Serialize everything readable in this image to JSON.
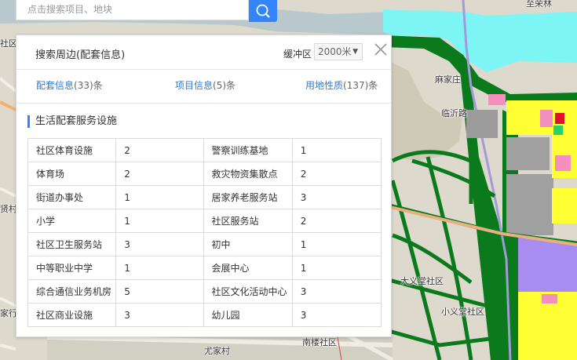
{
  "search": {
    "placeholder": "点击搜索项目、地块"
  },
  "map": {
    "labels": [
      "至荣林",
      "社区",
      "麻家庄",
      "临沂路",
      "贤村",
      "家行",
      "大义堂社区",
      "小义堂社区",
      "尤家村",
      "南楼社区"
    ]
  },
  "panel": {
    "title": "搜索周边(配套信息)",
    "buffer_label": "缓冲区",
    "buffer_value": "2000米",
    "tabs": [
      {
        "name": "配套信息",
        "count": "(33)条"
      },
      {
        "name": "项目信息",
        "count": "(5)条"
      },
      {
        "name": "用地性质",
        "count": "(137)条"
      }
    ],
    "section_title": "生活配套服务设施",
    "rows": [
      {
        "name1": "社区体育设施",
        "val1": "2",
        "name2": "警察训练基地",
        "val2": "1"
      },
      {
        "name1": "体育场",
        "val1": "2",
        "name2": "救灾物资集散点",
        "val2": "2"
      },
      {
        "name1": "街道办事处",
        "val1": "1",
        "name2": "居家养老服务站",
        "val2": "3"
      },
      {
        "name1": "小学",
        "val1": "1",
        "name2": "社区服务站",
        "val2": "2"
      },
      {
        "name1": "社区卫生服务站",
        "val1": "3",
        "name2": "初中",
        "val2": "1"
      },
      {
        "name1": "中等职业中学",
        "val1": "1",
        "name2": "会展中心",
        "val2": "1"
      },
      {
        "name1": "综合通信业务机房",
        "val1": "5",
        "name2": "社区文化活动中心",
        "val2": "3"
      },
      {
        "name1": "社区商业设施",
        "val1": "3",
        "name2": "幼儿园",
        "val2": "3"
      }
    ]
  },
  "colors": {
    "accent": "#3385ff",
    "link": "#2c7bd6",
    "river": "#7ef5f5",
    "green_zone": "#0b7a1c",
    "residential": "#ffff33",
    "industrial": "#a98cf0",
    "commercial": "#f58fbe"
  }
}
